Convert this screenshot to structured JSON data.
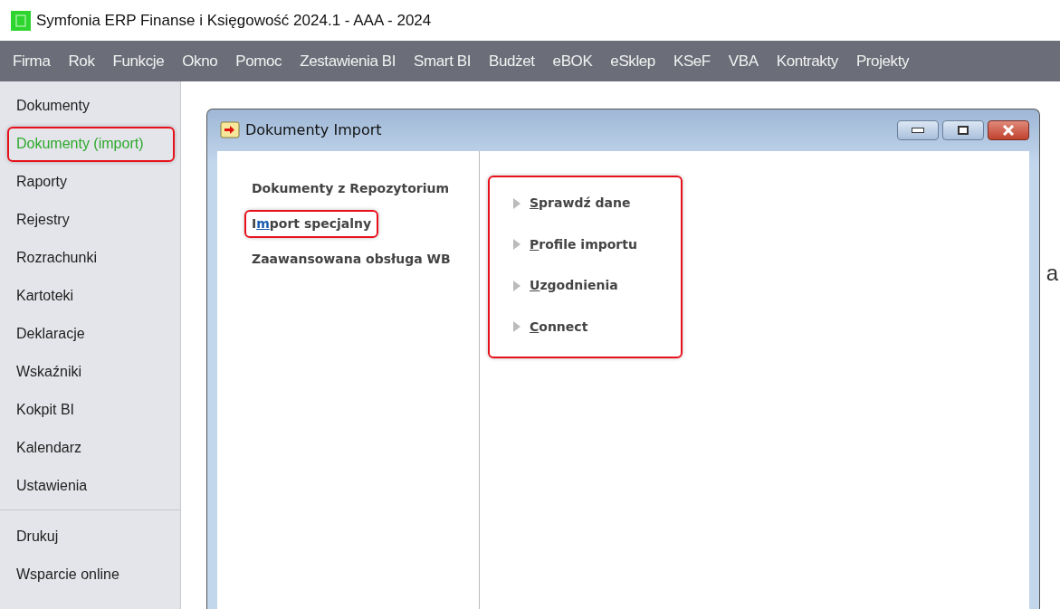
{
  "window": {
    "title": "Symfonia ERP Finanse i Księgowość 2024.1 - AAA - 2024"
  },
  "menu": [
    "Firma",
    "Rok",
    "Funkcje",
    "Okno",
    "Pomoc",
    "Zestawienia BI",
    "Smart BI",
    "Budżet",
    "eBOK",
    "eSklep",
    "KSeF",
    "VBA",
    "Kontrakty",
    "Projekty"
  ],
  "sidebar": {
    "groups": [
      [
        {
          "label": "Dokumenty",
          "selected": false,
          "highlighted": false
        },
        {
          "label": "Dokumenty (import)",
          "selected": true,
          "highlighted": true
        },
        {
          "label": "Raporty",
          "selected": false,
          "highlighted": false
        },
        {
          "label": "Rejestry",
          "selected": false,
          "highlighted": false
        },
        {
          "label": "Rozrachunki",
          "selected": false,
          "highlighted": false
        },
        {
          "label": "Kartoteki",
          "selected": false,
          "highlighted": false
        },
        {
          "label": "Deklaracje",
          "selected": false,
          "highlighted": false
        },
        {
          "label": "Wskaźniki",
          "selected": false,
          "highlighted": false
        },
        {
          "label": "Kokpit BI",
          "selected": false,
          "highlighted": false
        },
        {
          "label": "Kalendarz",
          "selected": false,
          "highlighted": false
        },
        {
          "label": "Ustawienia",
          "selected": false,
          "highlighted": false
        }
      ],
      [
        {
          "label": "Drukuj",
          "selected": false,
          "highlighted": false
        },
        {
          "label": "Wsparcie online",
          "selected": false,
          "highlighted": false
        }
      ]
    ]
  },
  "background_text": "a",
  "dialog": {
    "title": "Dokumenty Import",
    "categories": [
      {
        "parts": [
          {
            "text": "Dokumenty z Repozytorium",
            "underline": false
          }
        ],
        "highlighted": false
      },
      {
        "parts": [
          {
            "text": "I",
            "underline": false
          },
          {
            "text": "m",
            "underline": true
          },
          {
            "text": "port specjalny",
            "underline": false
          }
        ],
        "highlighted": true
      },
      {
        "parts": [
          {
            "text": "Zaawansowana obsługa WB",
            "underline": false
          }
        ],
        "highlighted": false
      }
    ],
    "options_highlighted": true,
    "options": [
      {
        "parts": [
          {
            "text": "S",
            "underline": true
          },
          {
            "text": "prawdź dane",
            "underline": false
          }
        ]
      },
      {
        "parts": [
          {
            "text": "P",
            "underline": true
          },
          {
            "text": "rofile importu",
            "underline": false
          }
        ]
      },
      {
        "parts": [
          {
            "text": "U",
            "underline": true
          },
          {
            "text": "zgodnienia",
            "underline": false
          }
        ]
      },
      {
        "parts": [
          {
            "text": "C",
            "underline": true
          },
          {
            "text": "onnect",
            "underline": false
          }
        ]
      }
    ]
  }
}
